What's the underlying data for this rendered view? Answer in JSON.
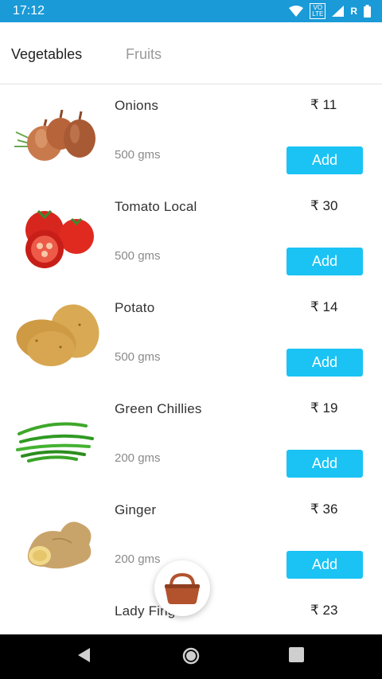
{
  "status": {
    "time": "17:12",
    "volte_top": "VO",
    "volte_bottom": "LTE",
    "roaming": "R"
  },
  "tabs": [
    {
      "label": "Vegetables"
    },
    {
      "label": "Fruits"
    }
  ],
  "products": [
    {
      "name": "Onions",
      "qty": "500 gms",
      "price": "₹ 11",
      "add_label": "Add",
      "image": "onion-image"
    },
    {
      "name": "Tomato Local",
      "qty": "500 gms",
      "price": "₹ 30",
      "add_label": "Add",
      "image": "tomato-image"
    },
    {
      "name": "Potato",
      "qty": "500 gms",
      "price": "₹ 14",
      "add_label": "Add",
      "image": "potato-image"
    },
    {
      "name": "Green Chillies",
      "qty": "200 gms",
      "price": "₹ 19",
      "add_label": "Add",
      "image": "chilli-image"
    },
    {
      "name": "Ginger",
      "qty": "200 gms",
      "price": "₹ 36",
      "add_label": "Add",
      "image": "ginger-image"
    },
    {
      "name": "Lady Finger",
      "qty": "",
      "price": "₹ 23",
      "add_label": "",
      "image": "lady-finger-image"
    }
  ],
  "fab": {
    "icon": "basket-icon"
  },
  "navbar": {
    "back": "back-icon",
    "home": "home-icon",
    "recents": "recents-icon"
  },
  "colors": {
    "status_bar": "#1a9ad7",
    "add_button": "#1ac3f4",
    "basket": "#b2532e"
  }
}
